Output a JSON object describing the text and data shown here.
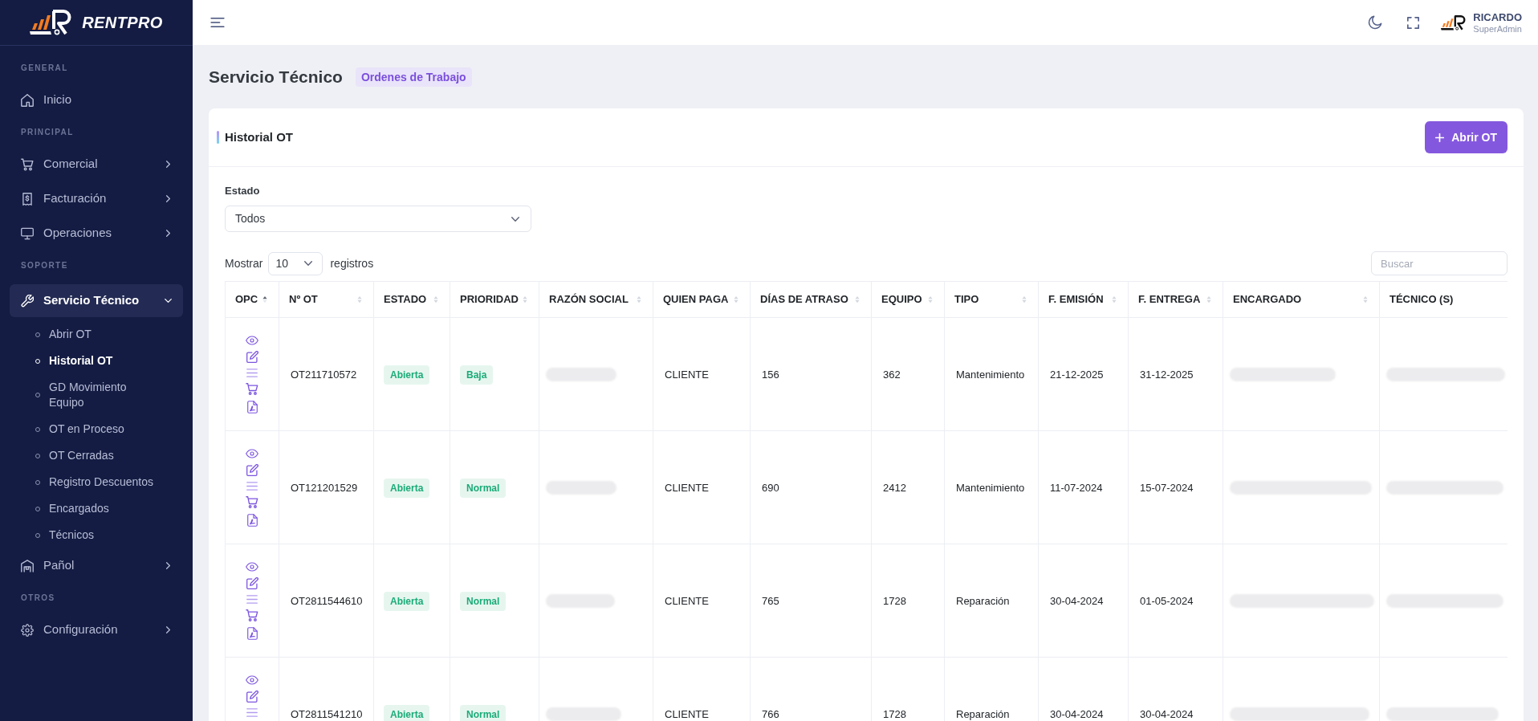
{
  "sidebar": {
    "brand": "RENTPRO",
    "sections": [
      {
        "label": "GENERAL",
        "items": [
          {
            "label": "Inicio",
            "kind": "link",
            "selected": false
          }
        ]
      },
      {
        "label": "PRINCIPAL",
        "items": [
          {
            "label": "Comercial",
            "kind": "menu",
            "selected": false,
            "expanded": false
          },
          {
            "label": "Facturación",
            "kind": "menu",
            "selected": false,
            "expanded": false
          },
          {
            "label": "Operaciones",
            "kind": "menu",
            "selected": false,
            "expanded": false
          }
        ]
      },
      {
        "label": "SOPORTE",
        "items": [
          {
            "label": "Servicio Técnico",
            "kind": "menu",
            "selected": true,
            "expanded": true,
            "children": [
              {
                "label": "Abrir OT",
                "selected": false
              },
              {
                "label": "Historial OT",
                "selected": true
              },
              {
                "label": "GD Movimiento Equipo",
                "selected": false
              },
              {
                "label": "OT en Proceso",
                "selected": false
              },
              {
                "label": "OT Cerradas",
                "selected": false
              },
              {
                "label": "Registro Descuentos",
                "selected": false
              },
              {
                "label": "Encargados",
                "selected": false
              },
              {
                "label": "Técnicos",
                "selected": false
              }
            ]
          },
          {
            "label": "Pañol",
            "kind": "menu",
            "selected": false,
            "expanded": false
          }
        ]
      },
      {
        "label": "OTROS",
        "items": [
          {
            "label": "Configuración",
            "kind": "menu",
            "selected": false,
            "expanded": false
          }
        ]
      }
    ]
  },
  "header": {
    "user": {
      "name": "RICARDO",
      "role": "SuperAdmin"
    }
  },
  "page": {
    "title": "Servicio Técnico",
    "badge": "Ordenes de Trabajo"
  },
  "card": {
    "title": "Historial OT",
    "primary_button": "Abrir OT",
    "filter": {
      "label": "Estado",
      "value": "Todos"
    },
    "page_size": {
      "prefix": "Mostrar",
      "value": "10",
      "suffix": "registros"
    },
    "search": {
      "placeholder": "Buscar"
    },
    "table": {
      "columns": [
        {
          "label": "OPC",
          "kind": "actions",
          "sortable": true,
          "sorted": true
        },
        {
          "label": "Nº OT",
          "kind": "text",
          "sortable": true,
          "sorted": false
        },
        {
          "label": "ESTADO",
          "kind": "badge",
          "sortable": true,
          "sorted": false
        },
        {
          "label": "PRIORIDAD",
          "kind": "badge",
          "sortable": true,
          "sorted": false
        },
        {
          "label": "RAZÓN SOCIAL",
          "kind": "redacted",
          "sortable": true,
          "sorted": false
        },
        {
          "label": "QUIEN PAGA",
          "kind": "text",
          "sortable": true,
          "sorted": false
        },
        {
          "label": "DÍAS DE ATRASO",
          "kind": "text",
          "sortable": true,
          "sorted": false
        },
        {
          "label": "EQUIPO",
          "kind": "text",
          "sortable": true,
          "sorted": false
        },
        {
          "label": "TIPO",
          "kind": "text",
          "sortable": true,
          "sorted": false
        },
        {
          "label": "F. EMISIÓN",
          "kind": "text",
          "sortable": true,
          "sorted": false
        },
        {
          "label": "F. ENTREGA",
          "kind": "text",
          "sortable": true,
          "sorted": false
        },
        {
          "label": "ENCARGADO",
          "kind": "redacted",
          "sortable": true,
          "sorted": false
        },
        {
          "label": "TÉCNICO (S)",
          "kind": "redacted",
          "sortable": false
        }
      ],
      "rows": [
        {
          "cells": [
            "",
            "OT211710572",
            "Abierta",
            "Baja",
            "",
            "CLIENTE",
            "156",
            "362",
            "Mantenimiento",
            "21-12-2025",
            "31-12-2025",
            "",
            ""
          ]
        },
        {
          "cells": [
            "",
            "OT121201529",
            "Abierta",
            "Normal",
            "",
            "CLIENTE",
            "690",
            "2412",
            "Mantenimiento",
            "11-07-2024",
            "15-07-2024",
            "",
            ""
          ]
        },
        {
          "cells": [
            "",
            "OT2811544610",
            "Abierta",
            "Normal",
            "",
            "CLIENTE",
            "765",
            "1728",
            "Reparación",
            "30-04-2024",
            "01-05-2024",
            "",
            ""
          ]
        },
        {
          "cells": [
            "",
            "OT2811541210",
            "Abierta",
            "Normal",
            "",
            "CLIENTE",
            "766",
            "1728",
            "Reparación",
            "30-04-2024",
            "30-04-2024",
            "",
            ""
          ]
        }
      ]
    }
  }
}
